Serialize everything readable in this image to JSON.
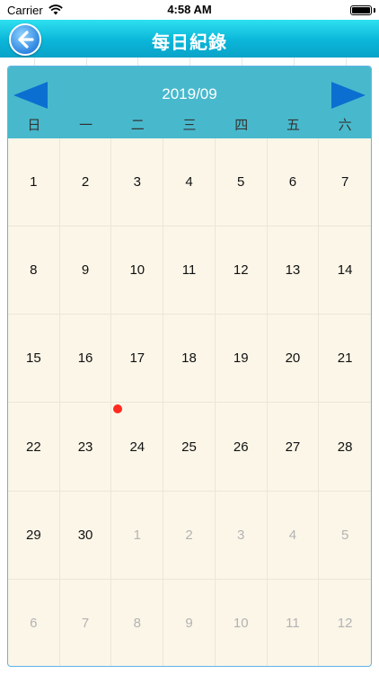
{
  "status_bar": {
    "carrier": "Carrier",
    "time": "4:58 AM"
  },
  "nav": {
    "title": "每日紀錄",
    "back_icon": "back-arrow-icon"
  },
  "calendar": {
    "month": "2019/09",
    "weekdays": [
      "日",
      "一",
      "二",
      "三",
      "四",
      "五",
      "六"
    ],
    "days": [
      {
        "d": "1",
        "cur": true
      },
      {
        "d": "2",
        "cur": true
      },
      {
        "d": "3",
        "cur": true
      },
      {
        "d": "4",
        "cur": true
      },
      {
        "d": "5",
        "cur": true
      },
      {
        "d": "6",
        "cur": true
      },
      {
        "d": "7",
        "cur": true
      },
      {
        "d": "8",
        "cur": true
      },
      {
        "d": "9",
        "cur": true
      },
      {
        "d": "10",
        "cur": true
      },
      {
        "d": "11",
        "cur": true
      },
      {
        "d": "12",
        "cur": true
      },
      {
        "d": "13",
        "cur": true
      },
      {
        "d": "14",
        "cur": true
      },
      {
        "d": "15",
        "cur": true
      },
      {
        "d": "16",
        "cur": true
      },
      {
        "d": "17",
        "cur": true
      },
      {
        "d": "18",
        "cur": true
      },
      {
        "d": "19",
        "cur": true
      },
      {
        "d": "20",
        "cur": true
      },
      {
        "d": "21",
        "cur": true
      },
      {
        "d": "22",
        "cur": true
      },
      {
        "d": "23",
        "cur": true
      },
      {
        "d": "24",
        "cur": true,
        "marked": true
      },
      {
        "d": "25",
        "cur": true
      },
      {
        "d": "26",
        "cur": true
      },
      {
        "d": "27",
        "cur": true
      },
      {
        "d": "28",
        "cur": true
      },
      {
        "d": "29",
        "cur": true
      },
      {
        "d": "30",
        "cur": true
      },
      {
        "d": "1",
        "cur": false
      },
      {
        "d": "2",
        "cur": false
      },
      {
        "d": "3",
        "cur": false
      },
      {
        "d": "4",
        "cur": false
      },
      {
        "d": "5",
        "cur": false
      },
      {
        "d": "6",
        "cur": false
      },
      {
        "d": "7",
        "cur": false
      },
      {
        "d": "8",
        "cur": false
      },
      {
        "d": "9",
        "cur": false
      },
      {
        "d": "10",
        "cur": false
      },
      {
        "d": "11",
        "cur": false
      },
      {
        "d": "12",
        "cur": false
      }
    ],
    "colors": {
      "header": "#48b9cd",
      "arrow": "#0a6fd0",
      "cell_bg": "#fbf6e8",
      "marker": "#ff2a1f"
    }
  }
}
